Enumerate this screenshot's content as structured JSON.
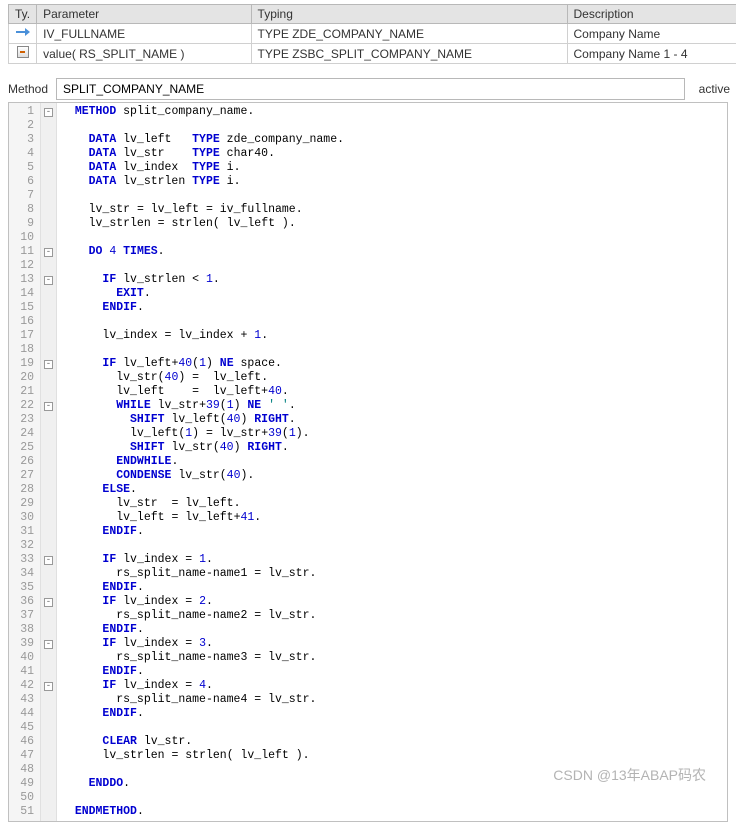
{
  "params": {
    "headers": {
      "type": "Ty.",
      "parameter": "Parameter",
      "typing": "Typing",
      "description": "Description"
    },
    "rows": [
      {
        "icon": "import",
        "parameter": "IV_FULLNAME",
        "typing": "TYPE ZDE_COMPANY_NAME",
        "description": "Company Name"
      },
      {
        "icon": "return",
        "parameter": "value( RS_SPLIT_NAME )",
        "typing": "TYPE ZSBC_SPLIT_COMPANY_NAME",
        "description": "Company Name 1 - 4"
      }
    ]
  },
  "method_bar": {
    "label": "Method",
    "value": "SPLIT_COMPANY_NAME",
    "status": "active"
  },
  "code_lines": [
    "METHOD split_company_name.",
    "",
    "  DATA lv_left   TYPE zde_company_name.",
    "  DATA lv_str    TYPE char40.",
    "  DATA lv_index  TYPE i.",
    "  DATA lv_strlen TYPE i.",
    "",
    "  lv_str = lv_left = iv_fullname.",
    "  lv_strlen = strlen( lv_left ).",
    "",
    "  DO 4 TIMES.",
    "",
    "    IF lv_strlen < 1.",
    "      EXIT.",
    "    ENDIF.",
    "",
    "    lv_index = lv_index + 1.",
    "",
    "    IF lv_left+40(1) NE space.",
    "      lv_str(40) =  lv_left.",
    "      lv_left    =  lv_left+40.",
    "      WHILE lv_str+39(1) NE ' '.",
    "        SHIFT lv_left(40) RIGHT.",
    "        lv_left(1) = lv_str+39(1).",
    "        SHIFT lv_str(40) RIGHT.",
    "      ENDWHILE.",
    "      CONDENSE lv_str(40).",
    "    ELSE.",
    "      lv_str  = lv_left.",
    "      lv_left = lv_left+41.",
    "    ENDIF.",
    "",
    "    IF lv_index = 1.",
    "      rs_split_name-name1 = lv_str.",
    "    ENDIF.",
    "    IF lv_index = 2.",
    "      rs_split_name-name2 = lv_str.",
    "    ENDIF.",
    "    IF lv_index = 3.",
    "      rs_split_name-name3 = lv_str.",
    "    ENDIF.",
    "    IF lv_index = 4.",
    "      rs_split_name-name4 = lv_str.",
    "    ENDIF.",
    "",
    "    CLEAR lv_str.",
    "    lv_strlen = strlen( lv_left ).",
    "",
    "  ENDDO.",
    "",
    "ENDMETHOD."
  ],
  "fold_lines": [
    1,
    11,
    13,
    19,
    22,
    33,
    36,
    39,
    42
  ],
  "watermark": "CSDN @13年ABAP码农"
}
